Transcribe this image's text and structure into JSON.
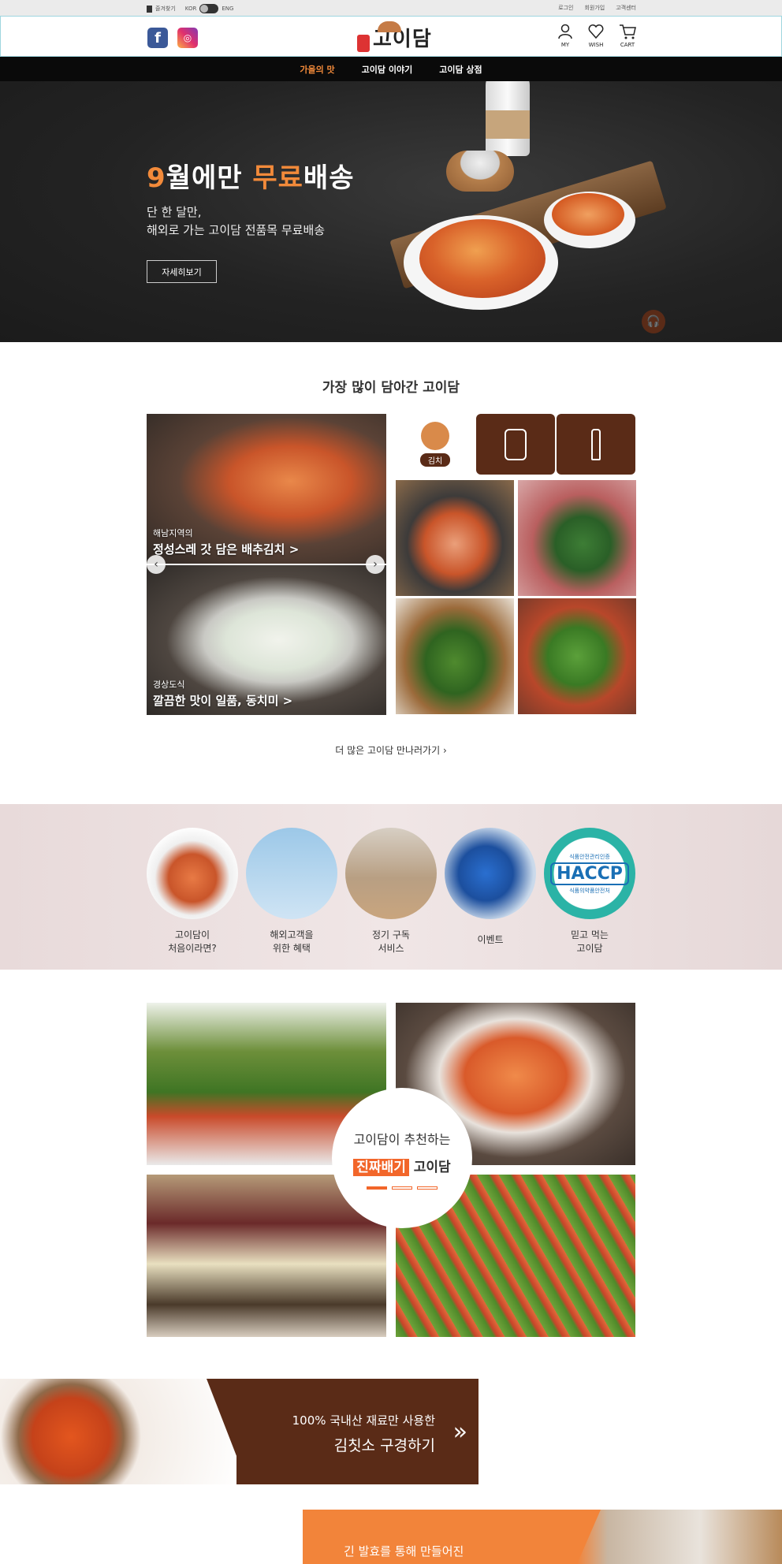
{
  "util": {
    "bookmark": "즐겨찾기",
    "lang_kor": "KOR",
    "lang_eng": "ENG",
    "links": [
      "로그인",
      "회원가입",
      "고객센터"
    ]
  },
  "header": {
    "logo_text": "고이담",
    "my": "MY",
    "wish": "WISH",
    "cart": "CART"
  },
  "nav": {
    "items": [
      "가을의 맛",
      "고이담 이야기",
      "고이담 상점"
    ]
  },
  "hero": {
    "title_1": "9",
    "title_2": "월에만 ",
    "title_3": "무료",
    "title_4": "배송",
    "sub_1": "단 한 달만,",
    "sub_2": "해외로 가는 고이담 전품목 무료배송",
    "button": "자세히보기"
  },
  "best": {
    "title": "가장 많이 담아간 고이담",
    "feat1_small": "해남지역의",
    "feat1_big": "정성스레 갓 담은 배추김치 >",
    "feat2_small": "경상도식",
    "feat2_big": "깔끔한 맛이 일품, 동치미 >",
    "cat_selected": "김치",
    "more": "더 많은 고이담 만나러가기 "
  },
  "services": [
    {
      "l1": "고이담이",
      "l2": "처음이라면?"
    },
    {
      "l1": "해외고객을",
      "l2": "위한 혜택"
    },
    {
      "l1": "정기 구독",
      "l2": "서비스"
    },
    {
      "l1": "이벤트",
      "l2": ""
    },
    {
      "l1": "믿고 먹는",
      "l2": "고이담"
    }
  ],
  "haccp": {
    "top": "식품안전관리인증",
    "mark": "HACCP",
    "bottom": "식품의약품안전처"
  },
  "recommend": {
    "line1": "고이담이 추천하는",
    "highlight": "진짜배기",
    "rest": " 고이담"
  },
  "kimchiso": {
    "line1": "100% 국내산 재료만 사용한",
    "line2": "김칫소 구경하기"
  },
  "bottom_banner": {
    "text": "긴 발효를 통해 만들어진"
  },
  "colors": {
    "accent": "#f28a3a",
    "brown": "#5a2b17",
    "nav_bg": "#0a0a0a"
  }
}
